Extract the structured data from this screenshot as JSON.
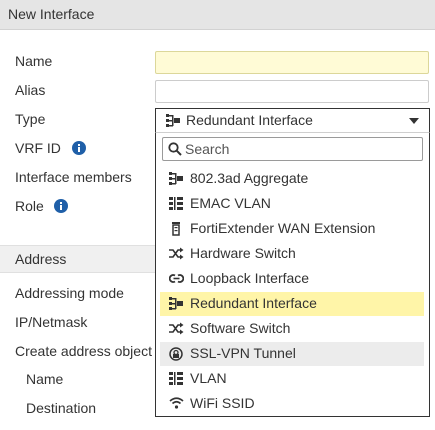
{
  "header": {
    "title": "New Interface"
  },
  "form": {
    "name_label": "Name",
    "alias_label": "Alias",
    "type_label": "Type",
    "vrf_label": "VRF ID",
    "members_label": "Interface members",
    "role_label": "Role",
    "address_section": "Address",
    "addressing_mode_label": "Addressing mode",
    "ipnetmask_label": "IP/Netmask",
    "create_address_label": "Create address object",
    "sub_name_label": "Name",
    "destination_label": "Destination",
    "name_value": "",
    "alias_value": ""
  },
  "type_select": {
    "value": "Redundant Interface",
    "icon": "redundant-icon"
  },
  "dropdown": {
    "search_placeholder": "Search",
    "options": [
      {
        "label": "802.3ad Aggregate",
        "icon": "aggregate-icon"
      },
      {
        "label": "EMAC VLAN",
        "icon": "emac-vlan-icon"
      },
      {
        "label": "FortiExtender WAN Extension",
        "icon": "extender-icon"
      },
      {
        "label": "Hardware Switch",
        "icon": "switch-icon"
      },
      {
        "label": "Loopback Interface",
        "icon": "loopback-icon"
      },
      {
        "label": "Redundant Interface",
        "icon": "redundant-icon",
        "selected": true
      },
      {
        "label": "Software Switch",
        "icon": "switch-icon"
      },
      {
        "label": "SSL-VPN Tunnel",
        "icon": "vpn-icon",
        "hover": true
      },
      {
        "label": "VLAN",
        "icon": "vlan-icon"
      },
      {
        "label": "WiFi SSID",
        "icon": "wifi-icon"
      }
    ]
  },
  "colors": {
    "selected_bg": "#fff5a8",
    "hover_bg": "#ececec",
    "info_icon": "#1f5fa8",
    "header_bg": "#e5e5e5"
  }
}
